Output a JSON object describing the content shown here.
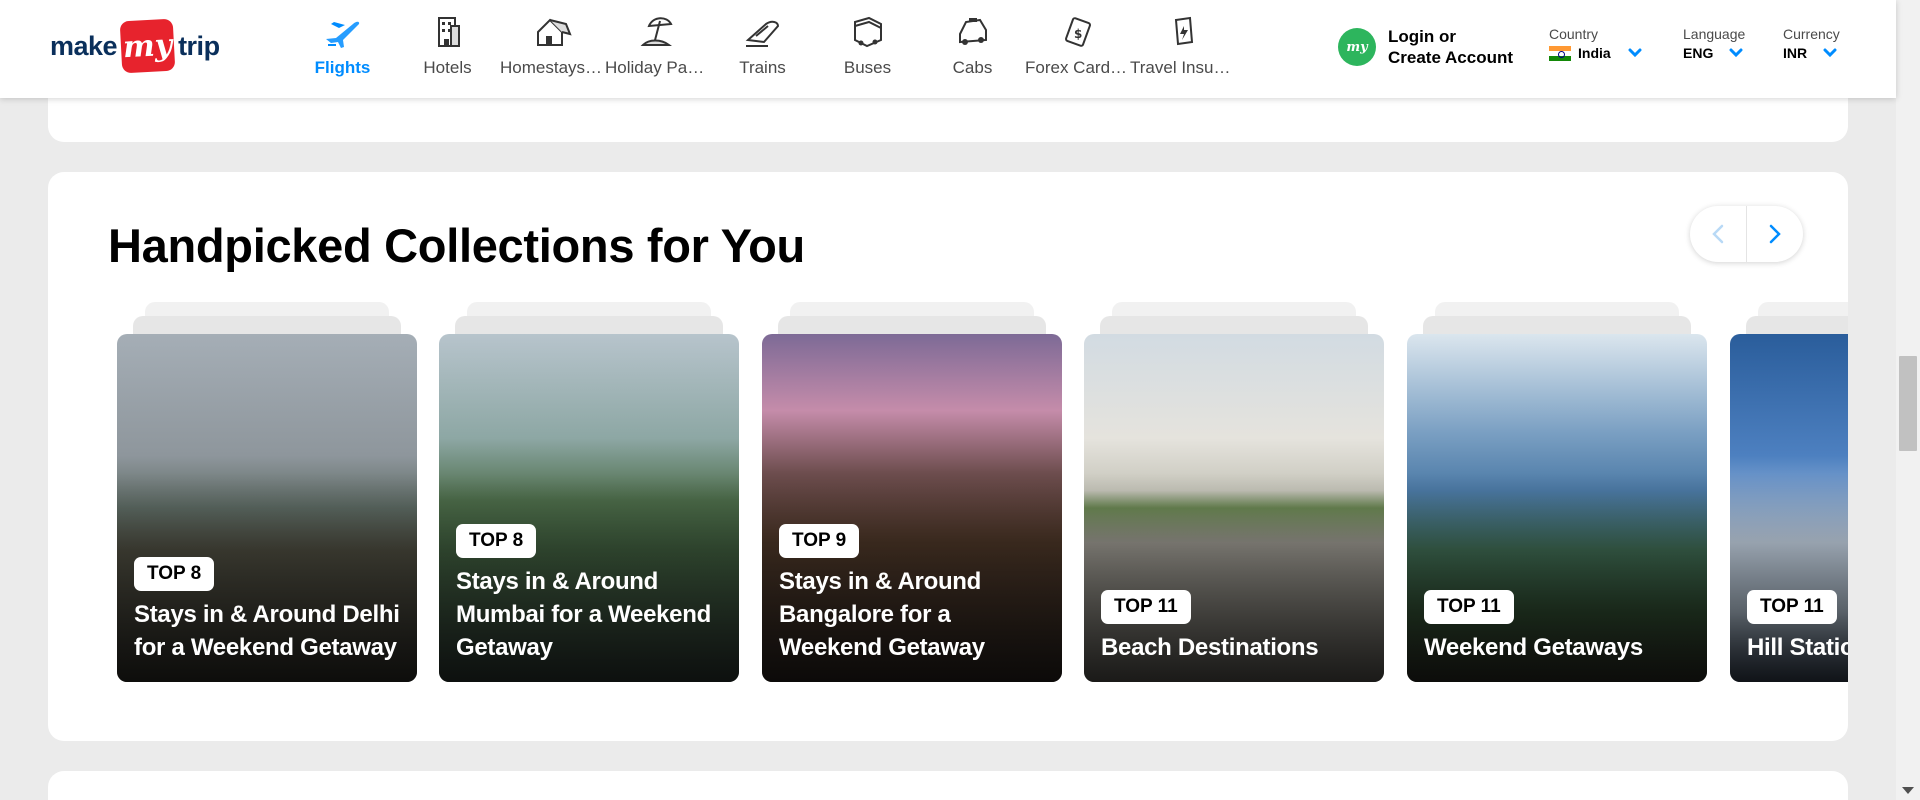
{
  "header": {
    "logo": {
      "left": "make",
      "badge": "my",
      "right": "trip"
    },
    "nav": [
      {
        "label": "Flights",
        "icon": "flight-icon",
        "active": true
      },
      {
        "label": "Hotels",
        "icon": "hotel-icon",
        "active": false
      },
      {
        "label": "Homestays & Villas",
        "icon": "homestay-icon",
        "active": false
      },
      {
        "label": "Holiday Packages",
        "icon": "holiday-package-icon",
        "active": false
      },
      {
        "label": "Trains",
        "icon": "train-icon",
        "active": false
      },
      {
        "label": "Buses",
        "icon": "bus-icon",
        "active": false
      },
      {
        "label": "Cabs",
        "icon": "cab-icon",
        "active": false
      },
      {
        "label": "Forex Card & Currency",
        "icon": "forex-icon",
        "active": false
      },
      {
        "label": "Travel Insurance",
        "icon": "travel-insurance-icon",
        "active": false
      }
    ],
    "login": {
      "avatar": "my",
      "line1": "Login or",
      "line2": "Create Account"
    },
    "country": {
      "caption": "Country",
      "value": "India"
    },
    "language": {
      "caption": "Language",
      "value": "ENG"
    },
    "currency": {
      "caption": "Currency",
      "value": "INR"
    }
  },
  "collections": {
    "title": "Handpicked Collections for You",
    "cards": [
      {
        "tag": "TOP 8",
        "name": "Stays in & Around Delhi for a Weekend Getaway"
      },
      {
        "tag": "TOP 8",
        "name": "Stays in & Around Mumbai for a Weekend Getaway"
      },
      {
        "tag": "TOP 9",
        "name": "Stays in & Around Bangalore for a Weekend Getaway"
      },
      {
        "tag": "TOP 11",
        "name": "Beach Destinations"
      },
      {
        "tag": "TOP 11",
        "name": "Weekend Getaways"
      },
      {
        "tag": "TOP 11",
        "name": "Hill Stations"
      }
    ]
  },
  "colors": {
    "accent": "#008cff",
    "brand_red": "#e7232d",
    "brand_navy": "#0a2f5b"
  }
}
